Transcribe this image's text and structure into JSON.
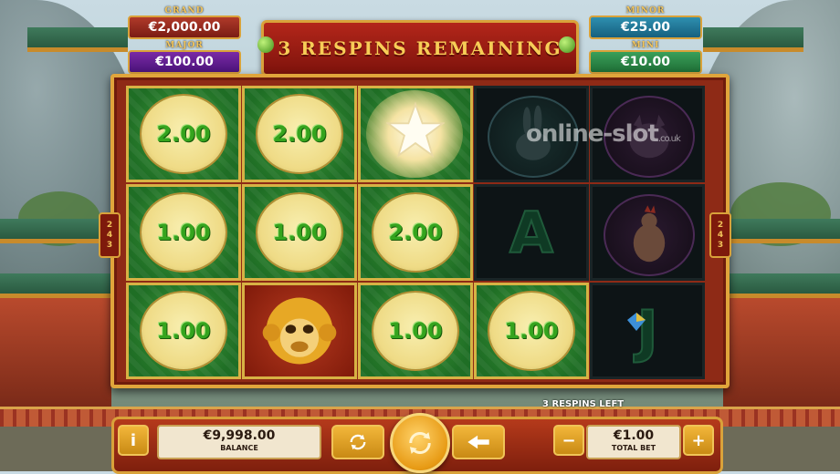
{
  "jackpots": {
    "grand": {
      "label": "GRAND",
      "value": "€2,000.00"
    },
    "major": {
      "label": "MAJOR",
      "value": "€100.00"
    },
    "minor": {
      "label": "MINOR",
      "value": "€25.00"
    },
    "mini": {
      "label": "MINI",
      "value": "€10.00"
    }
  },
  "banner": {
    "text": "3 RESPINS REMAINING"
  },
  "ways": {
    "left": [
      "2",
      "4",
      "3"
    ],
    "right": [
      "2",
      "4",
      "3"
    ]
  },
  "reels": [
    [
      {
        "type": "coin",
        "value": "2.00"
      },
      {
        "type": "coin",
        "value": "1.00"
      },
      {
        "type": "coin",
        "value": "1.00"
      }
    ],
    [
      {
        "type": "coin",
        "value": "2.00"
      },
      {
        "type": "coin",
        "value": "1.00"
      },
      {
        "type": "monkey",
        "icon": "monkey-icon"
      }
    ],
    [
      {
        "type": "star",
        "icon": "star-icon"
      },
      {
        "type": "coin",
        "value": "2.00"
      },
      {
        "type": "coin",
        "value": "1.00"
      }
    ],
    [
      {
        "type": "symbol",
        "icon": "rabbit-icon"
      },
      {
        "type": "letter",
        "value": "A"
      },
      {
        "type": "coin",
        "value": "1.00"
      }
    ],
    [
      {
        "type": "symbol",
        "icon": "pig-icon"
      },
      {
        "type": "symbol",
        "icon": "rooster-icon"
      },
      {
        "type": "letter",
        "value": "J"
      }
    ]
  ],
  "watermark": {
    "main": "online-slot",
    "suffix": ".co.uk"
  },
  "status": {
    "respins_left": "3 RESPINS LEFT"
  },
  "controls": {
    "info_label": "i",
    "balance": {
      "value": "€9,998.00",
      "label": "BALANCE"
    },
    "bet": {
      "value": "€1.00",
      "label": "TOTAL BET"
    },
    "minus_label": "−",
    "plus_label": "+",
    "icons": [
      "autoplay-icon",
      "spin-icon",
      "turbo-icon"
    ]
  },
  "colors": {
    "coin_text": "#35a41e",
    "banner_text": "#f7cd57",
    "frame_gold": "#e0a53b"
  }
}
